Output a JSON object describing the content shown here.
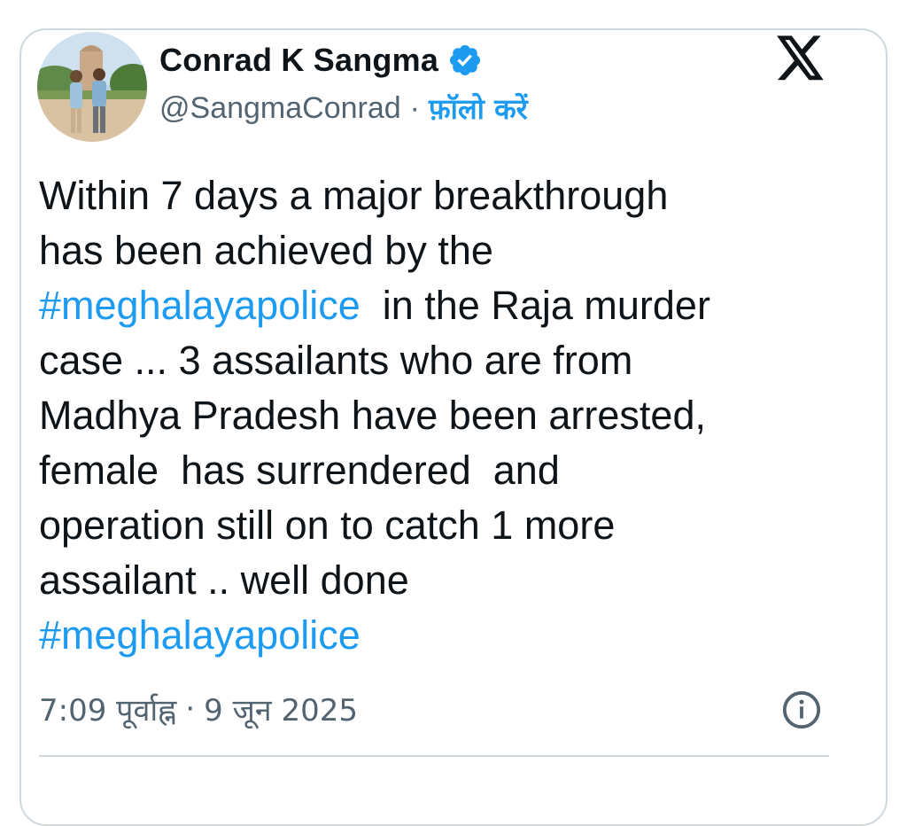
{
  "author": {
    "display_name": "Conrad K Sangma",
    "handle": "@SangmaConrad",
    "separator": "·",
    "follow_label": "फ़ॉलो करें",
    "verified": true
  },
  "tweet": {
    "lines": [
      {
        "parts": [
          {
            "text": "Within 7 days a major breakthrough",
            "type": "text"
          }
        ]
      },
      {
        "parts": [
          {
            "text": "has been achieved by the",
            "type": "text"
          }
        ]
      },
      {
        "parts": [
          {
            "text": "#meghalayapolice",
            "type": "hashtag"
          },
          {
            "text": "  in the Raja murder",
            "type": "text"
          }
        ]
      },
      {
        "parts": [
          {
            "text": "case ... 3 assailants who are from",
            "type": "text"
          }
        ]
      },
      {
        "parts": [
          {
            "text": "Madhya Pradesh have been arrested,",
            "type": "text"
          }
        ]
      },
      {
        "parts": [
          {
            "text": "female  has surrendered  and",
            "type": "text"
          }
        ]
      },
      {
        "parts": [
          {
            "text": "operation still on to catch 1 more",
            "type": "text"
          }
        ]
      },
      {
        "parts": [
          {
            "text": "assailant .. well done",
            "type": "text"
          }
        ]
      },
      {
        "parts": [
          {
            "text": "#meghalayapolice",
            "type": "hashtag"
          }
        ]
      }
    ]
  },
  "meta": {
    "time": "7:09 पूर्वाह्न",
    "separator": "·",
    "date": "9 जून 2025"
  },
  "icons": {
    "platform_logo": "x-logo-icon",
    "verified_badge": "verified-badge-icon",
    "info": "info-icon"
  },
  "colors": {
    "accent": "#1d9bf0",
    "text": "#0f1419",
    "secondary": "#536471",
    "border": "#cfd9de"
  }
}
